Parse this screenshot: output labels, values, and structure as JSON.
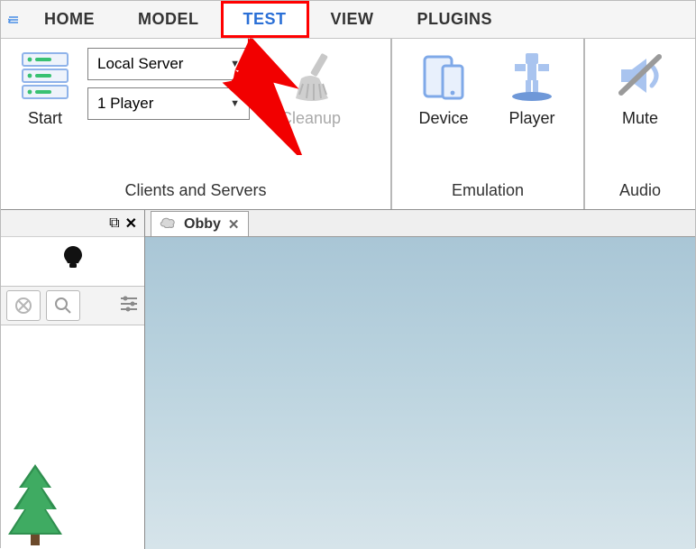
{
  "menu": {
    "items": [
      {
        "label": "HOME"
      },
      {
        "label": "MODEL"
      },
      {
        "label": "TEST"
      },
      {
        "label": "VIEW"
      },
      {
        "label": "PLUGINS"
      }
    ],
    "active_index": 2
  },
  "ribbon": {
    "groups": [
      {
        "title": "Clients and Servers",
        "start_label": "Start",
        "server_combo": "Local Server",
        "players_combo": "1 Player",
        "cleanup_label": "Cleanup"
      },
      {
        "title": "Emulation",
        "device_label": "Device",
        "player_label": "Player"
      },
      {
        "title": "Audio",
        "mute_label": "Mute"
      }
    ]
  },
  "document": {
    "tab_name": "Obby"
  }
}
